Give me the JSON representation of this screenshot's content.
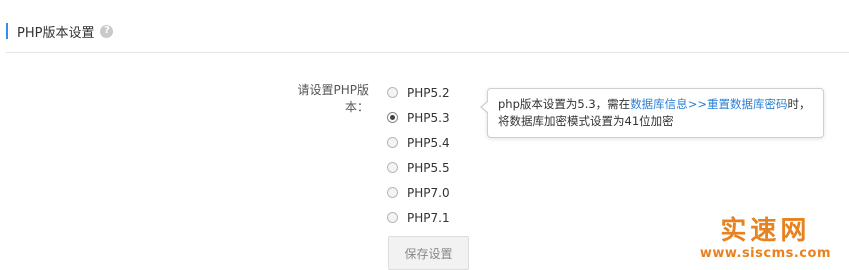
{
  "header": {
    "title": "PHP版本设置",
    "help_icon": "question-circle-icon"
  },
  "form": {
    "label": "请设置PHP版本：",
    "options": [
      {
        "label": "PHP5.2",
        "checked": false
      },
      {
        "label": "PHP5.3",
        "checked": true
      },
      {
        "label": "PHP5.4",
        "checked": false
      },
      {
        "label": "PHP5.5",
        "checked": false
      },
      {
        "label": "PHP7.0",
        "checked": false
      },
      {
        "label": "PHP7.1",
        "checked": false
      }
    ],
    "save_label": "保存设置"
  },
  "tooltip": {
    "prefix": "php版本设置为5.3，需在",
    "link1": "数据库信息",
    "sep": ">>",
    "link2": "重置数据库密码",
    "suffix": "时，",
    "line2": "将数据库加密模式设置为41位加密"
  },
  "watermark": {
    "title": "实速网",
    "url": "www.siscms.com"
  },
  "colors": {
    "accent": "#3b8fd9",
    "link": "#2a7fd4",
    "watermark": "#e8821f"
  }
}
